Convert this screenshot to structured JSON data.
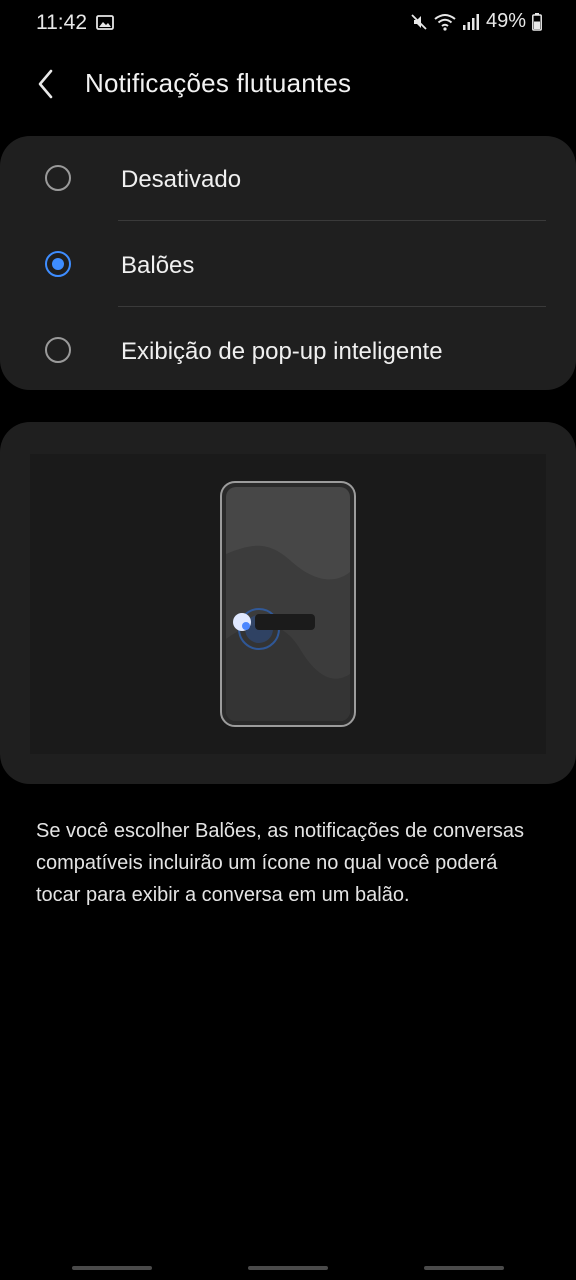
{
  "status_bar": {
    "time": "11:42",
    "battery": "49%",
    "icons": [
      "image-icon",
      "mute-icon",
      "wifi-icon",
      "signal-icon",
      "battery-icon"
    ]
  },
  "header": {
    "back_icon": "chevron-left-icon",
    "title": "Notificações flutuantes"
  },
  "options": {
    "items": [
      {
        "label": "Desativado",
        "selected": false
      },
      {
        "label": "Balões",
        "selected": true
      },
      {
        "label": "Exibição de pop-up inteligente",
        "selected": false
      }
    ]
  },
  "description": "Se você escolher Balões, as notificações de conversas compatíveis incluirão um ícone no qual você poderá tocar para exibir a conversa em um balão.",
  "colors": {
    "accent": "#3e8dff",
    "background": "#000000",
    "card": "#1f1f1f"
  }
}
